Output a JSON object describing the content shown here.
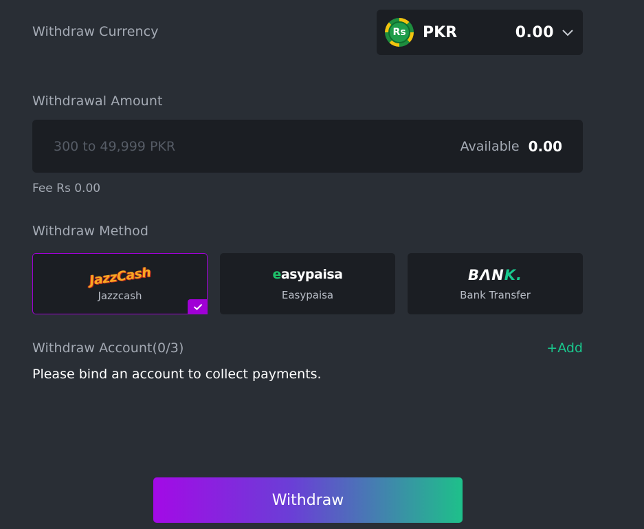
{
  "currency": {
    "label": "Withdraw Currency",
    "symbol": "Rs",
    "code": "PKR",
    "balance": "0.00",
    "icon": "chevron-down-icon"
  },
  "amount": {
    "label": "Withdrawal Amount",
    "placeholder": "300 to 49,999 PKR",
    "value": "",
    "available_label": "Available",
    "available_value": "0.00"
  },
  "fee": "Fee Rs 0.00",
  "methods": {
    "label": "Withdraw Method",
    "selected": "Jazzcash",
    "items": [
      {
        "logo_text_a": "Jazz",
        "logo_text_b": "Cash",
        "label": "Jazzcash"
      },
      {
        "logo_e": "e",
        "logo_rest": "asypaisa",
        "label": "Easypaisa"
      },
      {
        "logo_main": "BΛN",
        "logo_accent": "K.",
        "label": "Bank Transfer"
      }
    ]
  },
  "account": {
    "label": "Withdraw Account(0/3)",
    "add_label": "+Add",
    "notice": "Please bind an account to collect payments."
  },
  "withdraw_button": "Withdraw",
  "colors": {
    "background": "#292e35",
    "panel": "#1b1e23",
    "accent_purple": "#a000d6",
    "accent_green": "#19c98e"
  }
}
